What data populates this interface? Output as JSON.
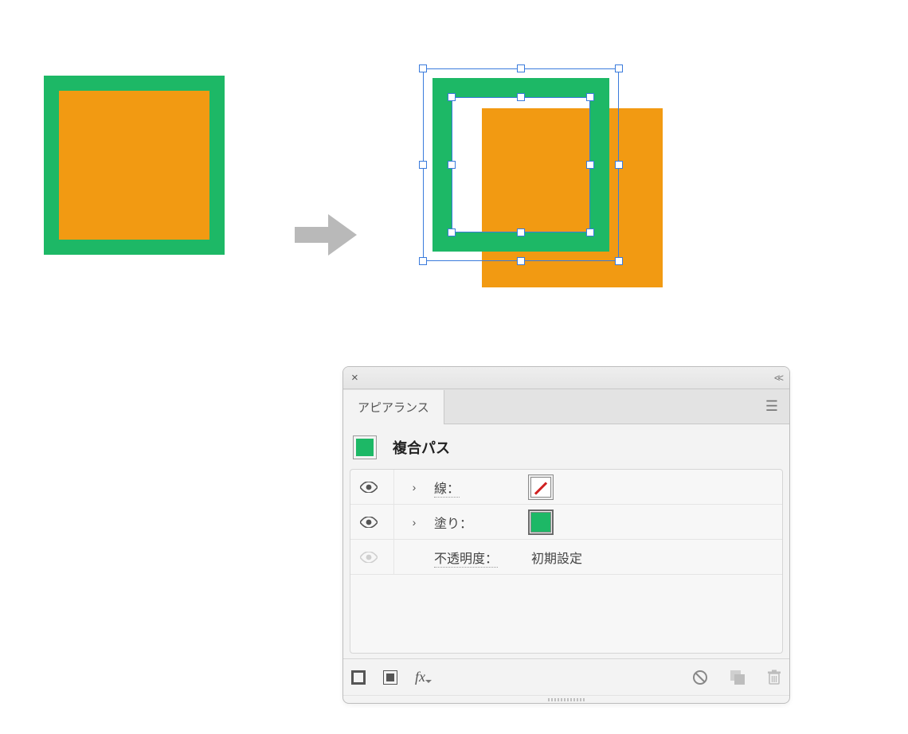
{
  "colors": {
    "green": "#1db866",
    "orange": "#f29a12",
    "selection": "#3a7bdc"
  },
  "panel": {
    "tab_label": "アピアランス",
    "title": "複合パス",
    "rows": {
      "stroke": {
        "label": "線：",
        "swatch": "none"
      },
      "fill": {
        "label": "塗り：",
        "swatch": "green"
      },
      "opacity": {
        "label": "不透明度：",
        "value": "初期設定"
      }
    },
    "footer_icons": {
      "stroke": "add-stroke",
      "fill": "add-fill",
      "fx": "fx",
      "clear": "clear",
      "duplicate": "duplicate",
      "delete": "delete"
    }
  }
}
